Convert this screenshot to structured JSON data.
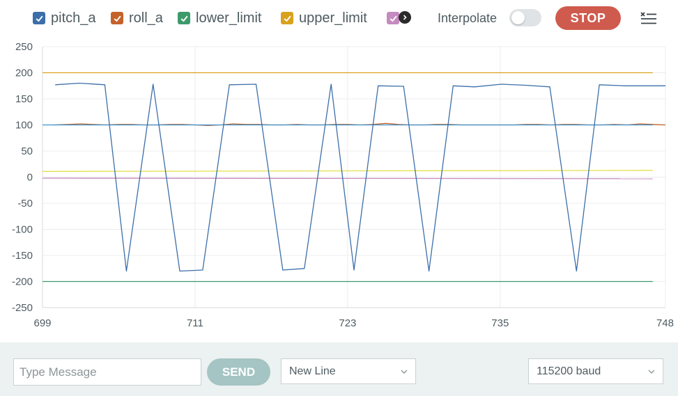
{
  "legend": {
    "items": [
      {
        "label": "pitch_a",
        "color": "#3c6eaa"
      },
      {
        "label": "roll_a",
        "color": "#c4622a"
      },
      {
        "label": "lower_limit",
        "color": "#3d9a6b"
      },
      {
        "label": "upper_limit",
        "color": "#d9a21e"
      },
      {
        "label": "",
        "color": "#c58ac0"
      }
    ],
    "overflow_icon": "chevron-right-icon",
    "interpolate_label": "Interpolate",
    "interpolate_on": false,
    "stop_label": "STOP",
    "menu_icon": "list-menu-icon"
  },
  "chart_data": {
    "type": "line",
    "xlim": [
      699,
      748
    ],
    "ylim": [
      -250,
      250
    ],
    "xticks": [
      699,
      711,
      723,
      735,
      748
    ],
    "yticks": [
      250,
      200,
      150,
      100,
      50,
      0,
      -50,
      -100,
      -150,
      -200,
      -250
    ],
    "grid": true,
    "series": [
      {
        "name": "upper_limit",
        "color": "#d9a21e",
        "x": [
          699,
          747
        ],
        "y": [
          200,
          200
        ]
      },
      {
        "name": "roll_a",
        "color": "#c4622a",
        "x": [
          699.9,
          701,
          702,
          703,
          704,
          705,
          706,
          707,
          708,
          709,
          710,
          711,
          712,
          713,
          714,
          715,
          716,
          717,
          718,
          719,
          720,
          721,
          722,
          723,
          724,
          725,
          726,
          727,
          728,
          729,
          730,
          731,
          732,
          733,
          734,
          735,
          736,
          737,
          738,
          739,
          740,
          741,
          742,
          743,
          744,
          745,
          746,
          747,
          748
        ],
        "y": [
          100,
          101,
          102,
          101,
          100,
          101,
          101,
          100,
          100,
          101,
          101,
          100,
          99,
          100,
          102,
          101,
          101,
          100,
          100,
          101,
          100,
          100,
          101,
          101,
          100,
          101,
          103,
          101,
          100,
          100,
          101,
          101,
          100,
          100,
          100,
          100,
          100,
          101,
          101,
          100,
          101,
          101,
          100,
          100,
          101,
          100,
          102,
          101,
          100
        ]
      },
      {
        "name": "lower_limit",
        "color": "#3d9a6b",
        "x": [
          699,
          747
        ],
        "y": [
          -200,
          -200
        ]
      },
      {
        "name": "",
        "color": "#e3e04a",
        "x": [
          699,
          747
        ],
        "y": [
          11,
          13
        ]
      },
      {
        "name": "",
        "color": "#c58ac0",
        "x": [
          699,
          747
        ],
        "y": [
          -2,
          -3
        ]
      },
      {
        "name": "",
        "color": "#3e93cf",
        "x": [
          699,
          747
        ],
        "y": [
          100,
          100
        ]
      },
      {
        "name": "pitch_a",
        "color": "#3c6eaa",
        "x": [
          700,
          701.9,
          703.9,
          705.6,
          707.7,
          709.8,
          711.6,
          713.7,
          715.8,
          717.9,
          719.6,
          721.7,
          723.5,
          725.4,
          727.4,
          729.4,
          731.3,
          733.0,
          735.1,
          737.0,
          738.9,
          741.0,
          742.8,
          744.8,
          746.7,
          748
        ],
        "y": [
          177,
          180,
          177,
          -180,
          178,
          -180,
          -178,
          177,
          178,
          -178,
          -175,
          178,
          -178,
          175,
          174,
          -180,
          175,
          173,
          178,
          176,
          173,
          -180,
          177,
          175,
          175,
          175
        ]
      }
    ]
  },
  "bottom": {
    "message_placeholder": "Type Message",
    "send_label": "SEND",
    "line_ending": "New Line",
    "baud": "115200 baud"
  }
}
